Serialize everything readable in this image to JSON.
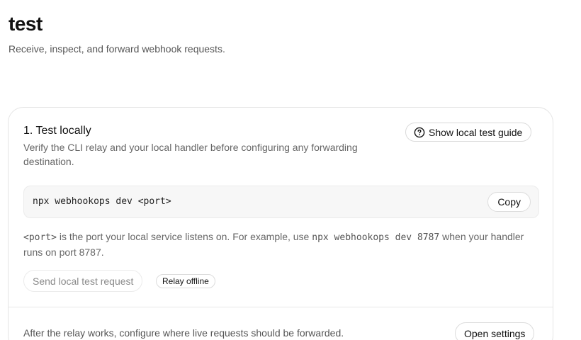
{
  "header": {
    "title": "test",
    "subtitle": "Receive, inspect, and forward webhook requests."
  },
  "step": {
    "title": "1. Test locally",
    "description": "Verify the CLI relay and your local handler before configuring any forwarding destination.",
    "guide_button": {
      "icon": "question-circle-icon",
      "label": "Show local test guide"
    },
    "command": "npx webhookops dev <port>",
    "copy_label": "Copy",
    "port_note": {
      "placeholder": "<port>",
      "text_1": " is the port your local service listens on. For example, use ",
      "example_command": "npx webhookops dev 8787",
      "text_2": " when your handler runs on port 8787."
    },
    "send_button_label": "Send local test request",
    "relay_status": "Relay offline"
  },
  "footer": {
    "text": "After the relay works, configure where live requests should be forwarded.",
    "settings_button_label": "Open settings"
  }
}
